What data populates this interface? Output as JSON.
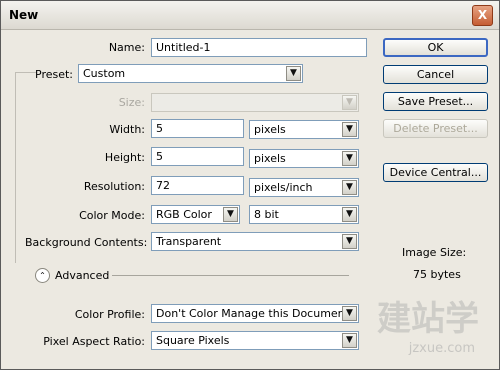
{
  "window": {
    "title": "New",
    "close_glyph": "X"
  },
  "form": {
    "name": {
      "label": "Name:",
      "value": "Untitled-1"
    },
    "preset": {
      "label": "Preset:",
      "value": "Custom"
    },
    "size": {
      "label": "Size:",
      "value": ""
    },
    "width": {
      "label": "Width:",
      "value": "5",
      "unit": "pixels"
    },
    "height": {
      "label": "Height:",
      "value": "5",
      "unit": "pixels"
    },
    "resolution": {
      "label": "Resolution:",
      "value": "72",
      "unit": "pixels/inch"
    },
    "color_mode": {
      "label": "Color Mode:",
      "value": "RGB Color",
      "depth": "8 bit"
    },
    "background": {
      "label": "Background Contents:",
      "value": "Transparent"
    },
    "advanced": {
      "label": "Advanced",
      "icon": "double-chevron-up-icon"
    },
    "color_profile": {
      "label": "Color Profile:",
      "value": "Don't Color Manage this Document"
    },
    "pixel_aspect": {
      "label": "Pixel Aspect Ratio:",
      "value": "Square Pixels"
    }
  },
  "buttons": {
    "ok": "OK",
    "cancel": "Cancel",
    "save_preset": "Save Preset...",
    "delete_preset": "Delete Preset...",
    "device_central": "Device Central..."
  },
  "image_size": {
    "label": "Image Size:",
    "value": "75 bytes"
  },
  "watermark": {
    "cn": "建站学",
    "url": "jzxue.com"
  },
  "icons": {
    "dropdown": "chevron-down-icon",
    "close": "close-icon"
  }
}
